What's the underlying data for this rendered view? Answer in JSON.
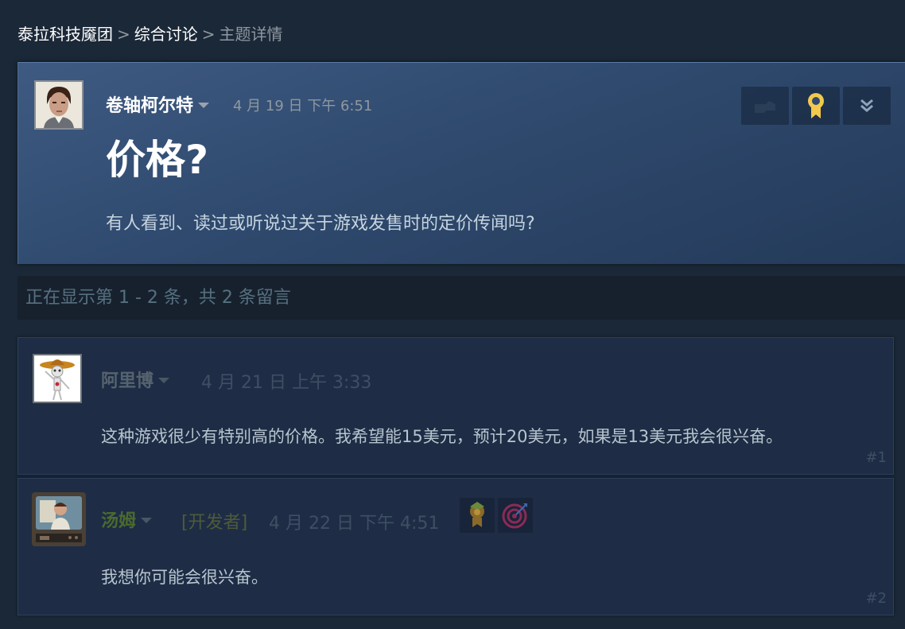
{
  "breadcrumb": {
    "group": "泰拉科技魇团",
    "section": "综合讨论",
    "current": "主题详情",
    "separator": ">"
  },
  "op": {
    "author": "卷轴柯尔特",
    "date": "4 月 19 日 下午 6:51",
    "title": "价格?",
    "body": "有人看到、读过或听说过关于游戏发售时的定价传闻吗?",
    "actions": [
      "thumb-icon",
      "award-ribbon-icon",
      "double-chevron-down-icon"
    ]
  },
  "showing": "正在显示第 1 - 2 条，共 2 条留言",
  "comments": [
    {
      "author": "阿里博",
      "date": "4 月 21 日 上午 3:33",
      "text": "这种游戏很少有特别高的价格。我希望能15美元，预计20美元，如果是13美元我会很兴奋。",
      "number": "#1"
    },
    {
      "author": "汤姆",
      "tag": "[开发者]",
      "date": "4 月 22 日 下午 4:51",
      "text": "我想你可能会很兴奋。",
      "number": "#2",
      "badges": [
        "trophy-badge-icon",
        "target-badge-icon"
      ]
    }
  ],
  "colors": {
    "background": "#1b2838",
    "op_gradient_start": "#3f5a82",
    "developer_name": "#4b6a2e",
    "award_gold": "#f2c94c"
  }
}
